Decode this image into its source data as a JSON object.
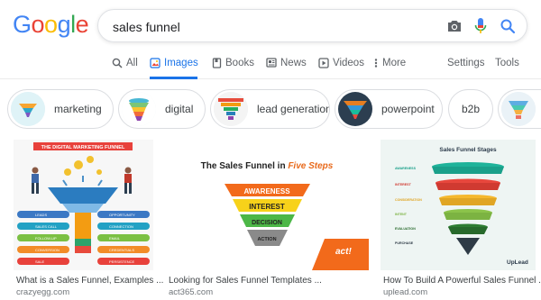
{
  "logo": {
    "letters": [
      "G",
      "o",
      "o",
      "g",
      "l",
      "e"
    ],
    "colors": [
      "#4285f4",
      "#ea4335",
      "#fbbc05",
      "#4285f4",
      "#34a853",
      "#ea4335"
    ]
  },
  "search": {
    "value": "sales funnel",
    "placeholder": ""
  },
  "icons": {
    "camera": "camera-icon",
    "mic": "microphone-icon",
    "search": "search-icon"
  },
  "tabs": {
    "all": "All",
    "images": "Images",
    "books": "Books",
    "news": "News",
    "videos": "Videos",
    "more": "More",
    "settings": "Settings",
    "tools": "Tools"
  },
  "chips": [
    {
      "label": "marketing"
    },
    {
      "label": "digital"
    },
    {
      "label": "lead generation"
    },
    {
      "label": "powerpoint"
    },
    {
      "label": "b2b"
    }
  ],
  "results": [
    {
      "title": "What is a Sales Funnel, Examples ...",
      "source": "crazyegg.com",
      "image": {
        "heading": "THE DIGITAL MARKETING FUNNEL",
        "left_labels": [
          "LEADS",
          "SALES CALL",
          "FOLLOW-UP",
          "CONVERSION",
          "SALE"
        ],
        "right_labels": [
          "OPPORTUNITY",
          "CONNECTION",
          "EMAIL",
          "CREDENTIALS",
          "PERSISTENCE"
        ]
      }
    },
    {
      "title": "Looking for Sales Funnel Templates ...",
      "source": "act365.com",
      "image": {
        "heading_plain": "The Sales Funnel in ",
        "heading_emph": "Five Steps",
        "levels": [
          "AWARENESS",
          "INTEREST",
          "DECISION",
          "ACTION"
        ],
        "brand": "act!"
      }
    },
    {
      "title": "How To Build A Powerful Sales Funnel ...",
      "source": "uplead.com",
      "image": {
        "heading": "Sales Funnel Stages",
        "stages": [
          "AWARENESS",
          "INTEREST",
          "CONSIDERATION",
          "INTENT",
          "EVALUATION",
          "PURCHASE"
        ],
        "brand": "UpLead"
      }
    }
  ]
}
